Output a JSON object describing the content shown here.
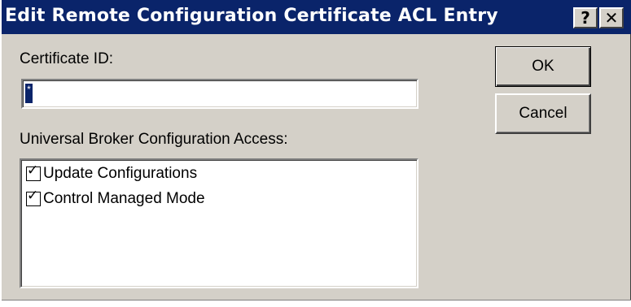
{
  "window": {
    "title": "Edit Remote Configuration Certificate ACL Entry",
    "help_glyph": "?",
    "close_glyph": "✕"
  },
  "form": {
    "certificate_id_label": "Certificate ID:",
    "certificate_id_value": "",
    "access_label": "Universal Broker Configuration Access:",
    "access_items": [
      {
        "label": "Update Configurations",
        "checked": true
      },
      {
        "label": "Control Managed Mode",
        "checked": true
      }
    ]
  },
  "buttons": {
    "ok_label": "OK",
    "cancel_label": "Cancel"
  },
  "colors": {
    "titlebar": "#0a246a",
    "dialog_face": "#d4d0c8"
  }
}
